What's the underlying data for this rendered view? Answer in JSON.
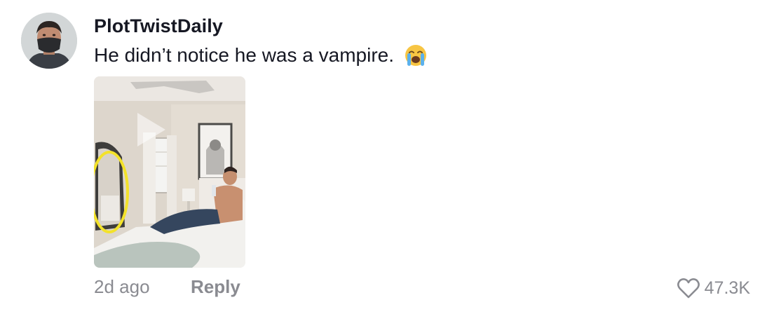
{
  "comment": {
    "username": "PlotTwistDaily",
    "text": "He didn’t notice he was a vampire.",
    "emoji": "loudly-crying-face-emoji",
    "timestamp": "2d ago",
    "reply_label": "Reply",
    "likes": "47.3K"
  },
  "icons": {
    "like": "heart-outline-icon",
    "media_play": "play-icon"
  },
  "colors": {
    "primary_text": "#161823",
    "secondary_text": "#8a8b91",
    "annotation_circle": "#f3e22a"
  }
}
